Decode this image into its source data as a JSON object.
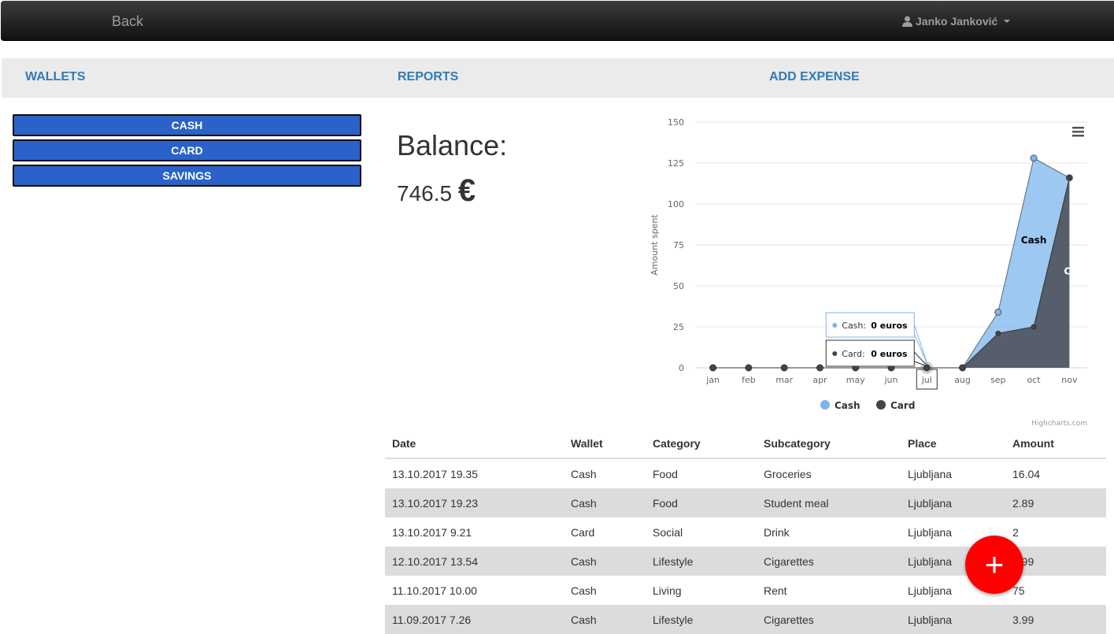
{
  "navbar": {
    "back_label": "Back",
    "user_name": "Janko Janković",
    "user_icon": "user-icon"
  },
  "tabs": [
    {
      "label": "WALLETS"
    },
    {
      "label": "REPORTS"
    },
    {
      "label": "ADD EXPENSE"
    }
  ],
  "wallets": [
    {
      "label": "CASH"
    },
    {
      "label": "CARD"
    },
    {
      "label": "SAVINGS"
    }
  ],
  "balance": {
    "label": "Balance:",
    "value": "746.5",
    "currency": "€"
  },
  "chart_data": {
    "type": "area",
    "categories": [
      "jan",
      "feb",
      "mar",
      "apr",
      "may",
      "jun",
      "jul",
      "aug",
      "sep",
      "oct",
      "nov"
    ],
    "series": [
      {
        "name": "Cash",
        "color": "#7cb5ec",
        "values": [
          0,
          0,
          0,
          0,
          0,
          0,
          0,
          0,
          34,
          128,
          116
        ]
      },
      {
        "name": "Card",
        "color": "#434348",
        "values": [
          0,
          0,
          0,
          0,
          0,
          0,
          0,
          0,
          21,
          25,
          116
        ]
      }
    ],
    "ylabel": "Amount spent",
    "ylim": [
      0,
      150
    ],
    "yticks": [
      "0",
      "25",
      "50",
      "75",
      "100",
      "125",
      "150"
    ],
    "grid": true,
    "legend": "bottom-center",
    "series_labels": [
      "Cash",
      "Ca"
    ],
    "tooltip": {
      "category": "jul",
      "cash_label": "Cash:",
      "cash_value": "0 euros",
      "card_label": "Card:",
      "card_value": "0 euros"
    },
    "credits": "Highcharts.com"
  },
  "table": {
    "headers": [
      "Date",
      "Wallet",
      "Category",
      "Subcategory",
      "Place",
      "Amount"
    ],
    "rows": [
      [
        "13.10.2017 19.35",
        "Cash",
        "Food",
        "Groceries",
        "Ljubljana",
        "16.04"
      ],
      [
        "13.10.2017 19.23",
        "Cash",
        "Food",
        "Student meal",
        "Ljubljana",
        "2.89"
      ],
      [
        "13.10.2017 9.21",
        "Card",
        "Social",
        "Drink",
        "Ljubljana",
        "2"
      ],
      [
        "12.10.2017 13.54",
        "Cash",
        "Lifestyle",
        "Cigarettes",
        "Ljubljana",
        "3.99"
      ],
      [
        "11.10.2017 10.00",
        "Cash",
        "Living",
        "Rent",
        "Ljubljana",
        "75"
      ],
      [
        "11.09.2017 7.26",
        "Cash",
        "Lifestyle",
        "Cigarettes",
        "Ljubljana",
        "3.99"
      ]
    ]
  },
  "fab": {
    "label": "+"
  }
}
